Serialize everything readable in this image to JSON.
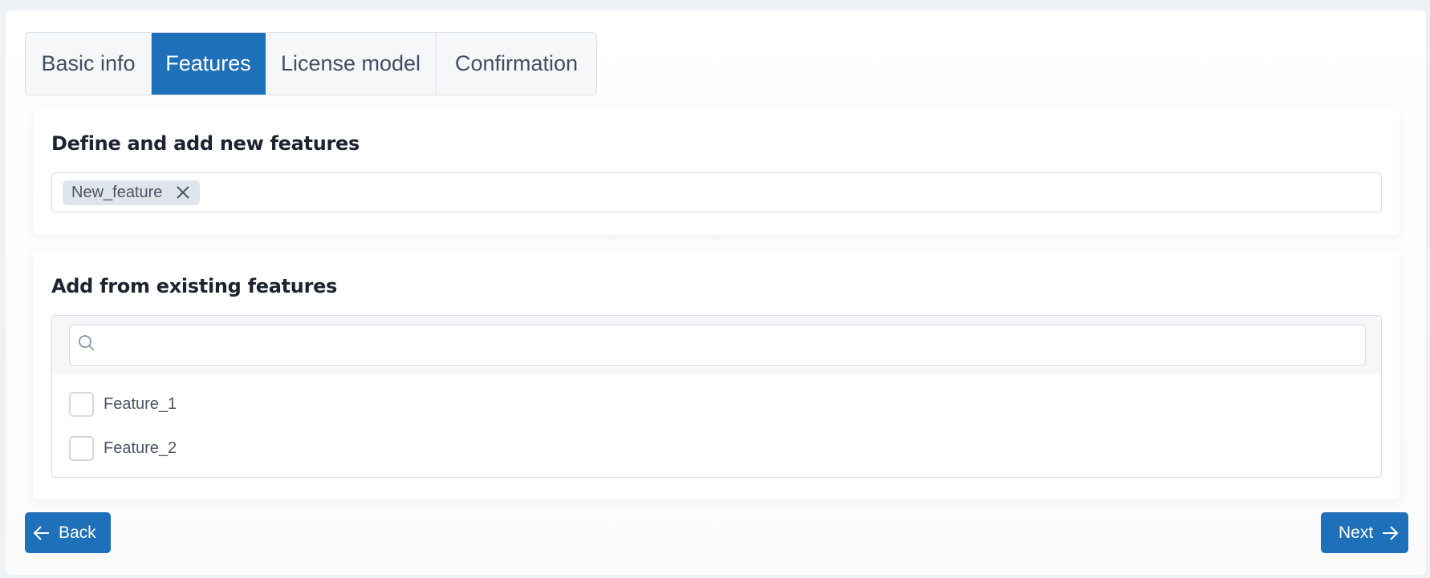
{
  "tabs": [
    {
      "label": "Basic info",
      "active": false
    },
    {
      "label": "Features",
      "active": true
    },
    {
      "label": "License model",
      "active": false
    },
    {
      "label": "Confirmation",
      "active": false
    }
  ],
  "new_features": {
    "title": "Define and add new features",
    "chips": [
      {
        "label": "New_feature",
        "icon": "close-icon"
      }
    ]
  },
  "existing_features": {
    "title": "Add from existing features",
    "search": {
      "value": "",
      "placeholder": "",
      "icon": "search-icon"
    },
    "options": [
      {
        "label": "Feature_1",
        "checked": false
      },
      {
        "label": "Feature_2",
        "checked": false
      }
    ]
  },
  "footer": {
    "back_label": "Back",
    "back_icon": "arrow-left-icon",
    "next_label": "Next",
    "next_icon": "arrow-right-icon"
  },
  "colors": {
    "primary": "#1e70b8",
    "chip_bg": "#e0e5ec",
    "border": "#d6dbe3"
  }
}
